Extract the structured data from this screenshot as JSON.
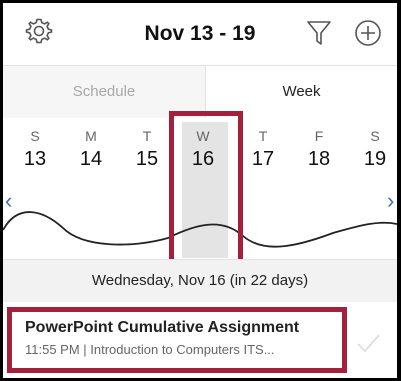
{
  "header": {
    "title": "Nov 13 - 19",
    "settings_icon": "gear-icon",
    "filter_icon": "filter-icon",
    "add_icon": "plus-circle-icon"
  },
  "tabs": [
    {
      "label": "Schedule",
      "active": false
    },
    {
      "label": "Week",
      "active": true
    }
  ],
  "week": {
    "days": [
      {
        "letter": "S",
        "date": "13"
      },
      {
        "letter": "M",
        "date": "14"
      },
      {
        "letter": "T",
        "date": "15"
      },
      {
        "letter": "W",
        "date": "16",
        "selected": true
      },
      {
        "letter": "T",
        "date": "17"
      },
      {
        "letter": "F",
        "date": "18"
      },
      {
        "letter": "S",
        "date": "19"
      }
    ],
    "prev_icon": "chevron-left-icon",
    "next_icon": "chevron-right-icon"
  },
  "selected_date_label": "Wednesday, Nov 16 (in 22 days)",
  "assignment": {
    "title": "PowerPoint Cumulative Assignment",
    "details": "11:55 PM | Introduction to Computers ITS...",
    "check_icon": "checkmark-icon"
  },
  "colors": {
    "highlight": "#a3213a",
    "accent": "#3a6fb3"
  }
}
